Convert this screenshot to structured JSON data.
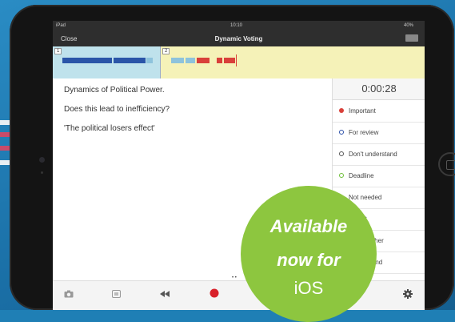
{
  "status": {
    "left": "iPad",
    "time": "10:10",
    "battery": "40%"
  },
  "nav": {
    "close_label": "Close",
    "title": "Dynamic Voting"
  },
  "timeline": {
    "seg1_number": "1",
    "seg2_number": "2"
  },
  "content": {
    "lines": [
      "Dynamics of Political Power.",
      "Does this lead to inefficiency?",
      "'The political losers effect'"
    ]
  },
  "side": {
    "timer": "0:00:28",
    "options": [
      {
        "label": "Important",
        "color": "#d9403a"
      },
      {
        "label": "For review",
        "color": "#2b4fa8"
      },
      {
        "label": "Don't understand",
        "color": "#555555"
      },
      {
        "label": "Deadline",
        "color": "#6fbf3a"
      },
      {
        "label": "Not needed",
        "color": "#999999"
      },
      {
        "label": "nt",
        "color": "#999999"
      },
      {
        "label": "Further",
        "color": "#999999"
      },
      {
        "label": "rstand",
        "color": "#999999"
      }
    ]
  },
  "toolbar": {
    "camera_icon": "camera-icon",
    "slides_icon": "slides-icon",
    "rewind_icon": "rewind-icon",
    "record_icon": "record-icon",
    "settings_icon": "gear-icon"
  },
  "pager": {
    "dots": "• •"
  },
  "badge": {
    "line1": "Available",
    "line2": "now for",
    "line3": "iOS",
    "color": "#8dc63f"
  }
}
